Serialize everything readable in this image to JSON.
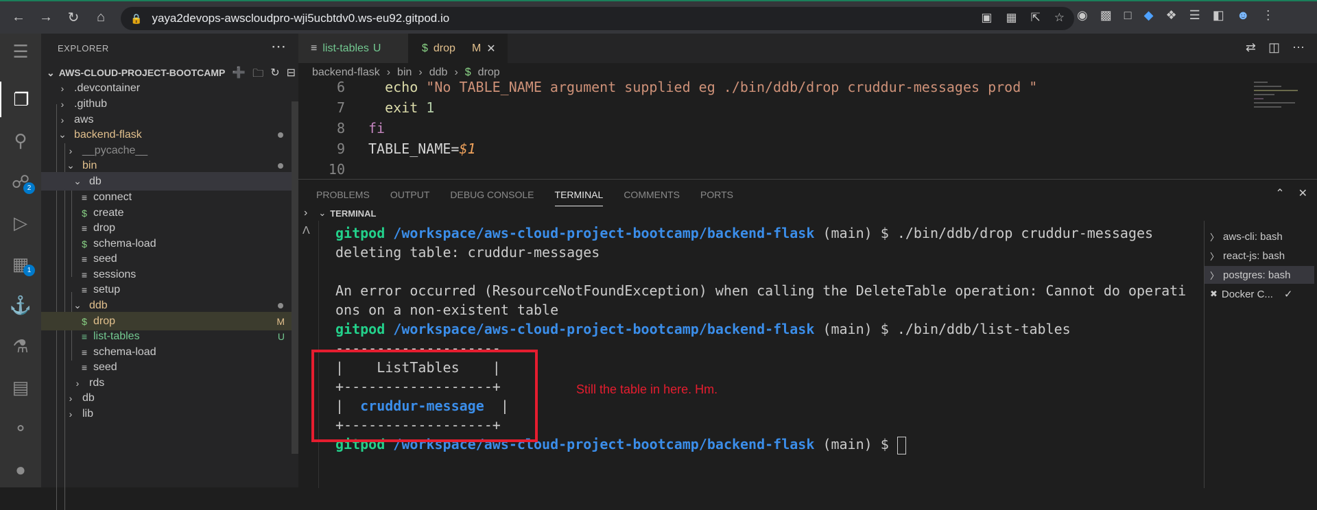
{
  "browser": {
    "url": "yaya2devops-awscloudpro-wji5ucbtdv0.ws-eu92.gitpod.io"
  },
  "sidebar": {
    "title": "EXPLORER",
    "section": "AWS-CLOUD-PROJECT-BOOTCAMP",
    "tree": [
      {
        "label": ".devcontainer"
      },
      {
        "label": ".github"
      },
      {
        "label": "aws"
      },
      {
        "label": "backend-flask"
      },
      {
        "label": "__pycache__"
      },
      {
        "label": "bin"
      },
      {
        "label": "db"
      },
      {
        "label": "connect"
      },
      {
        "label": "create"
      },
      {
        "label": "drop"
      },
      {
        "label": "schema-load"
      },
      {
        "label": "seed"
      },
      {
        "label": "sessions"
      },
      {
        "label": "setup"
      },
      {
        "label": "ddb"
      },
      {
        "label": "drop",
        "status": "M"
      },
      {
        "label": "list-tables",
        "status": "U"
      },
      {
        "label": "schema-load"
      },
      {
        "label": "seed"
      },
      {
        "label": "rds"
      },
      {
        "label": "db"
      },
      {
        "label": "lib"
      }
    ],
    "badges": {
      "scm": "2",
      "extensions": "1"
    }
  },
  "tabs": [
    {
      "label": "list-tables",
      "status": "U"
    },
    {
      "label": "drop",
      "status": "M"
    }
  ],
  "breadcrumb": [
    "backend-flask",
    "bin",
    "ddb",
    "drop"
  ],
  "code": [
    {
      "n": "6",
      "text": "  echo \"No TABLE_NAME argument supplied eg ./bin/ddb/drop cruddur-messages prod \""
    },
    {
      "n": "7",
      "text": "  exit 1"
    },
    {
      "n": "8",
      "text": "fi"
    },
    {
      "n": "9",
      "text": "TABLE_NAME=$1"
    },
    {
      "n": "10",
      "text": ""
    }
  ],
  "panel": {
    "tabs": [
      "PROBLEMS",
      "OUTPUT",
      "DEBUG CONSOLE",
      "TERMINAL",
      "COMMENTS",
      "PORTS"
    ],
    "terminal_header": "TERMINAL"
  },
  "terminal": {
    "prompt_user": "gitpod",
    "prompt_path": "/workspace/aws-cloud-project-bootcamp/backend-flask",
    "prompt_branch": "(main) $",
    "cmd1": "./bin/ddb/drop cruddur-messages",
    "out1": "deleting table: cruddur-messages",
    "out2a": "An error occurred (ResourceNotFoundException) when calling the DeleteTable operation: Cannot do operati",
    "out2b": "ons on a non-existent table",
    "cmd2": "./bin/ddb/list-tables",
    "tbl1": "--------------------",
    "tbl2": "|    ListTables    |",
    "tbl3": "+------------------+",
    "tbl4_pre": "|  ",
    "tbl4_val": "cruddur-message",
    "tbl4_post": "  |",
    "tbl5": "+------------------+"
  },
  "terminal_tabs": [
    {
      "label": "aws-cli: bash"
    },
    {
      "label": "react-js: bash"
    },
    {
      "label": "postgres: bash"
    },
    {
      "label": "Docker C..."
    }
  ],
  "annotation": "Still the table in here. Hm."
}
